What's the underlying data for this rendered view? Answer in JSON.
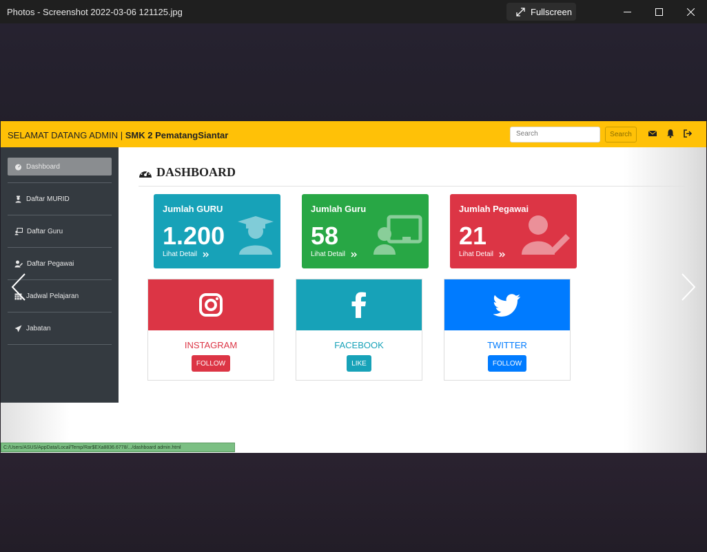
{
  "window": {
    "title": "Photos - Screenshot 2022-03-06 121125.jpg",
    "fullscreen_label": "Fullscreen"
  },
  "navbar": {
    "welcome": "SELAMAT DATANG ADMIN",
    "separator": "|",
    "school": "SMK 2 PematangSiantar",
    "search_placeholder": "Search",
    "search_button": "Search",
    "bg_color": "#ffc107"
  },
  "sidebar": {
    "items": [
      {
        "label": "Dashboard",
        "icon": "gauge-icon",
        "active": true
      },
      {
        "label": "Daftar MURID",
        "icon": "student-icon"
      },
      {
        "label": "Daftar Guru",
        "icon": "chalkboard-teacher-icon"
      },
      {
        "label": "Daftar Pegawai",
        "icon": "user-edit-icon"
      },
      {
        "label": "Jadwal Pelajaran",
        "icon": "calendar-icon"
      },
      {
        "label": "Jabatan",
        "icon": "paper-plane-icon"
      }
    ]
  },
  "main": {
    "title": "DASHBOARD",
    "stats": [
      {
        "label": "Jumlah GURU",
        "value": "1.200",
        "detail": "Lihat Detail",
        "color": "#17a2b8"
      },
      {
        "label": "Jumlah Guru",
        "value": "58",
        "detail": "Lihat Detail",
        "color": "#28a745"
      },
      {
        "label": "Jumlah Pegawai",
        "value": "21",
        "detail": "Lihat Detail",
        "color": "#dc3545"
      }
    ],
    "social": [
      {
        "name": "INSTAGRAM",
        "button": "FOLLOW",
        "color": "#dc3545"
      },
      {
        "name": "FACEBOOK",
        "button": "LIKE",
        "color": "#17a2b8"
      },
      {
        "name": "TWITTER",
        "button": "FOLLOW",
        "color": "#007bff"
      }
    ]
  },
  "statusbar": {
    "url": "C:/Users/ASUS/AppData/Local/Temp/Rar$EXa8836.6778/.../dashboard admin.html"
  }
}
